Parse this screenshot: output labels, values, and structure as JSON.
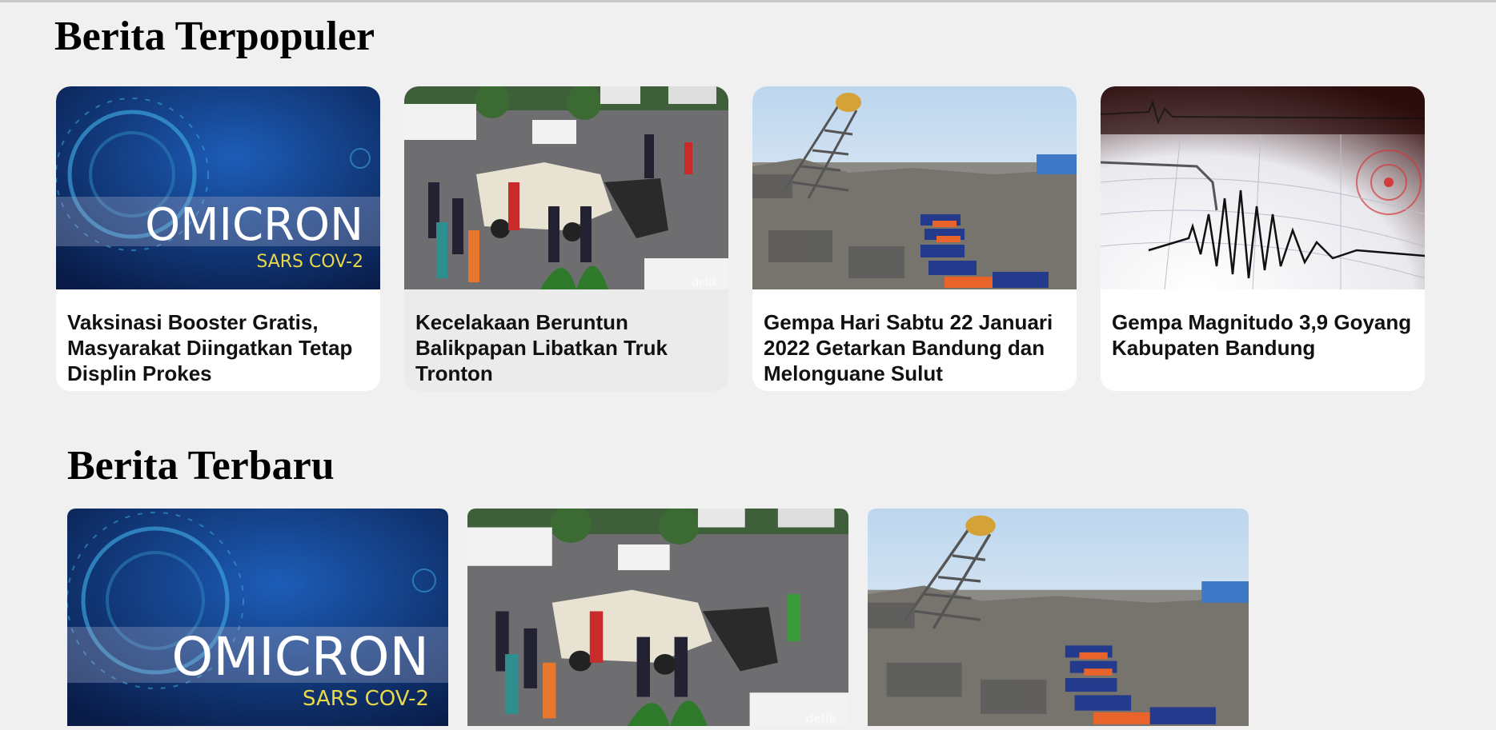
{
  "sections": {
    "popular": {
      "title": "Berita Terpopuler",
      "cards": [
        {
          "title": "Vaksinasi Booster Gratis, Masyarakat Diingatkan Tetap Displin Prokes",
          "image": "omicron-virus-image"
        },
        {
          "title": "Kecelakaan Beruntun Balikpapan Libatkan Truk Tronton",
          "image": "crash-scene-image"
        },
        {
          "title": "Gempa Hari Sabtu 22 Januari 2022 Getarkan Bandung dan Melonguane Sulut",
          "image": "earthquake-ruins-image"
        },
        {
          "title": "Gempa Magnitudo 3,9 Goyang Kabupaten Bandung",
          "image": "seismograph-image"
        }
      ]
    },
    "latest": {
      "title": "Berita Terbaru",
      "cards": [
        {
          "image": "omicron-virus-image"
        },
        {
          "image": "crash-scene-image"
        },
        {
          "image": "earthquake-ruins-image"
        }
      ]
    }
  },
  "image_text": {
    "omicron_word": "OMICRON",
    "omicron_sub": "SARS COV-2",
    "watermark": "detik"
  },
  "colors": {
    "page_bg": "#f0f0f0",
    "card_bg": "#ffffff",
    "card_hover_bg": "#ebebeb",
    "title_text": "#000000"
  }
}
